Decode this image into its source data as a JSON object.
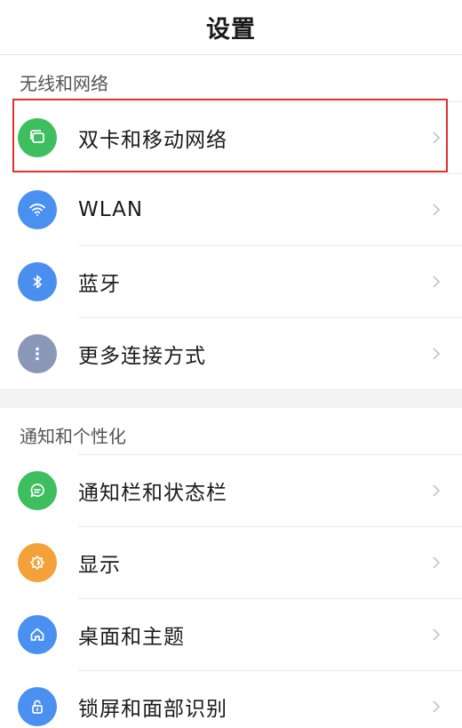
{
  "header": {
    "title": "设置"
  },
  "sections": [
    {
      "label": "无线和网络",
      "items": [
        {
          "label": "双卡和移动网络",
          "icon": "sim-cards-icon",
          "color": "#3dbf5f"
        },
        {
          "label": "WLAN",
          "icon": "wifi-icon",
          "color": "#4a90f0"
        },
        {
          "label": "蓝牙",
          "icon": "bluetooth-icon",
          "color": "#4a8ef0"
        },
        {
          "label": "更多连接方式",
          "icon": "more-dots-icon",
          "color": "#8a98b8"
        }
      ]
    },
    {
      "label": "通知和个性化",
      "items": [
        {
          "label": "通知栏和状态栏",
          "icon": "notification-icon",
          "color": "#3dbf5f"
        },
        {
          "label": "显示",
          "icon": "brightness-icon",
          "color": "#f5a13a"
        },
        {
          "label": "桌面和主题",
          "icon": "home-icon",
          "color": "#4a90f0"
        },
        {
          "label": "锁屏和面部识别",
          "icon": "lock-icon",
          "color": "#4a90f0"
        }
      ]
    }
  ],
  "highlight": {
    "color": "#e03030",
    "target": "双卡和移动网络"
  }
}
